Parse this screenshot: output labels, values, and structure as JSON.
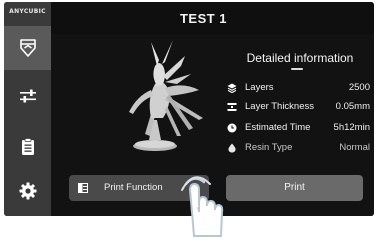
{
  "brand": "ANYCUBIC",
  "header": {
    "title": "TEST 1"
  },
  "sidebar": {
    "items": [
      {
        "name": "files",
        "icon": "shield-file-icon",
        "active": true
      },
      {
        "name": "adjust",
        "icon": "sliders-icon",
        "active": false
      },
      {
        "name": "logs",
        "icon": "document-list-icon",
        "active": false
      },
      {
        "name": "settings",
        "icon": "gear-icon",
        "active": false
      }
    ]
  },
  "info": {
    "title": "Detailed information",
    "rows": [
      {
        "icon": "layers-icon",
        "label": "Layers",
        "value": "2500"
      },
      {
        "icon": "layer-thickness-icon",
        "label": "Layer Thickness",
        "value": "0.05mm"
      },
      {
        "icon": "clock-icon",
        "label": "Estimated Time",
        "value": "5h12min"
      },
      {
        "icon": "resin-drop-icon",
        "label": "Resin Type",
        "value": "Normal"
      }
    ]
  },
  "buttons": {
    "print_function": "Print Function",
    "print": "Print"
  },
  "colors": {
    "sidebar": "#3a3a3a",
    "screen": "#121212",
    "button": "#4a4a4a",
    "print_button": "#6a6a6a"
  }
}
